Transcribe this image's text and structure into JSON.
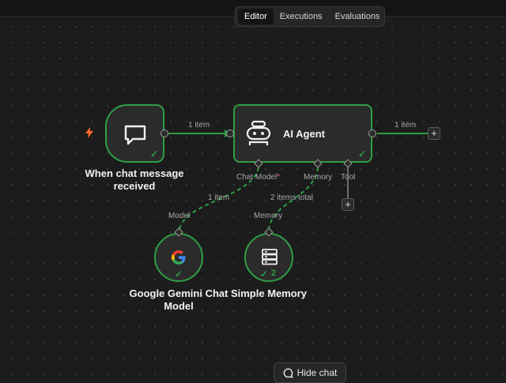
{
  "tabs": [
    {
      "label": "Editor",
      "active": true
    },
    {
      "label": "Executions",
      "active": false
    },
    {
      "label": "Evaluations",
      "active": false
    }
  ],
  "trigger": {
    "title_line1": "When chat message",
    "title_line2": "received",
    "icon": "chat-bubble-icon",
    "status": "success"
  },
  "agent": {
    "title": "AI Agent",
    "icon": "robot-icon",
    "status": "success",
    "ports": {
      "chat_model": "Chat Model",
      "chat_model_required": "*",
      "memory": "Memory",
      "tool": "Tool"
    }
  },
  "connections": {
    "trigger_to_agent": "1 item",
    "agent_output": "1 item",
    "model_to_agent": "1 item",
    "memory_to_agent": "2 items total"
  },
  "gemini": {
    "port_label": "Model",
    "title_line1": "Google Gemini Chat",
    "title_line2": "Model",
    "icon": "google-g-icon",
    "status": "success"
  },
  "memory": {
    "port_label": "Memory",
    "title": "Simple Memory",
    "icon": "database-icon",
    "run_count": "2",
    "status": "success"
  },
  "hide_chat": {
    "label": "Hide chat",
    "icon": "chat-icon"
  },
  "colors": {
    "success": "#2f9e44",
    "canvas": "#1c1c1c",
    "node": "#2b2b2b",
    "trigger_bolt": "#ff6d2d",
    "required": "#ff6b6b"
  }
}
